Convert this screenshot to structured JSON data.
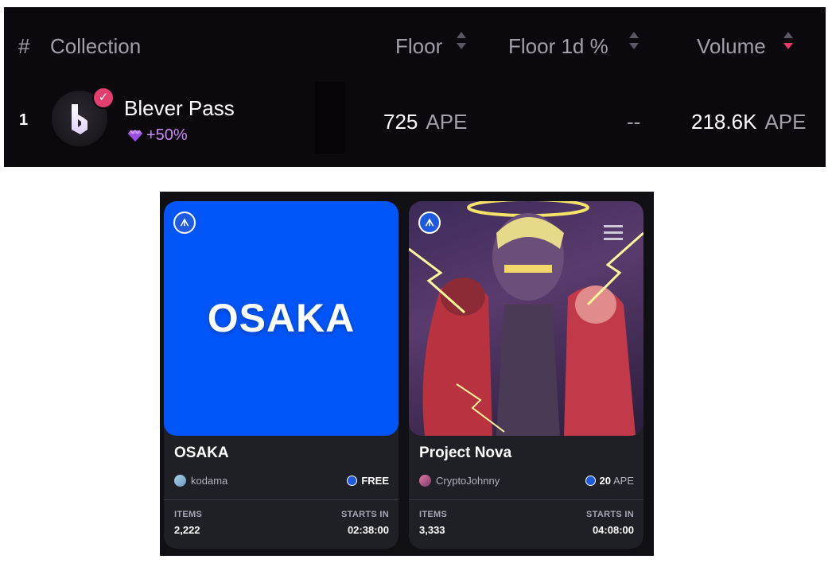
{
  "table": {
    "headers": {
      "hash": "#",
      "collection": "Collection",
      "floor": "Floor",
      "floor_1d": "Floor 1d %",
      "volume": "Volume"
    },
    "rows": [
      {
        "rank": "1",
        "name": "Blever Pass",
        "verified": true,
        "gem_bonus": "+50%",
        "floor_value": "725",
        "floor_unit": "APE",
        "floor_1d": "--",
        "volume_value": "218.6K",
        "volume_unit": "APE"
      }
    ],
    "colors": {
      "verified": "#e23e6e",
      "sort_active": "#e83a6c",
      "gem": "#c78af7"
    }
  },
  "cards": [
    {
      "image_text": "OSAKA",
      "title": "OSAKA",
      "creator": "kodama",
      "price": "FREE",
      "price_unit": "",
      "items_label": "ITEMS",
      "items_value": "2,222",
      "starts_label": "STARTS IN",
      "starts_value": "02:38:00"
    },
    {
      "image_text": "",
      "title": "Project Nova",
      "creator": "CryptoJohnny",
      "price": "20",
      "price_unit": "APE",
      "items_label": "ITEMS",
      "items_value": "3,333",
      "starts_label": "STARTS IN",
      "starts_value": "04:08:00"
    }
  ]
}
